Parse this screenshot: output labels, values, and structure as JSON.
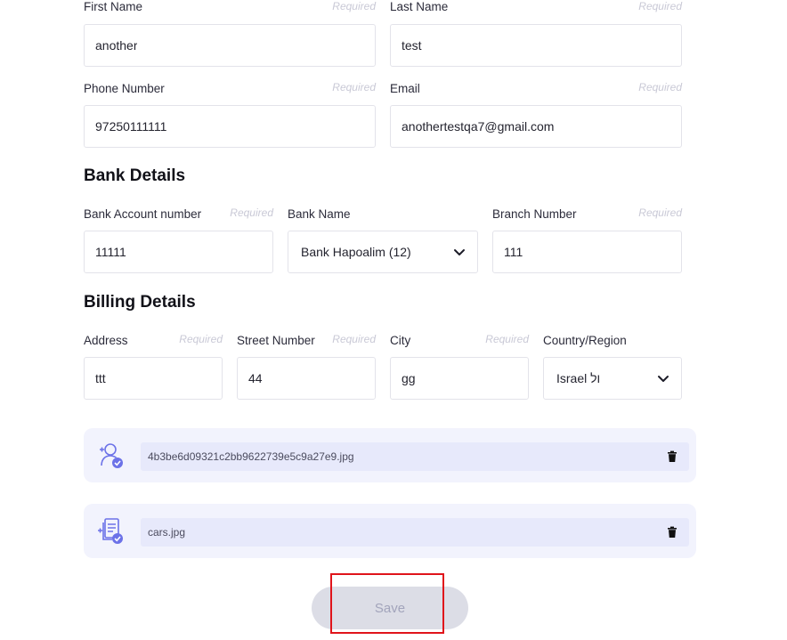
{
  "personal": {
    "first_name": {
      "label": "First Name",
      "required": "Required",
      "value": "another"
    },
    "last_name": {
      "label": "Last Name",
      "required": "Required",
      "value": "test"
    },
    "phone": {
      "label": "Phone Number",
      "required": "Required",
      "value": "97250111111"
    },
    "email": {
      "label": "Email",
      "required": "Required",
      "value": "anothertestqa7@gmail.com"
    }
  },
  "bank": {
    "title": "Bank Details",
    "account": {
      "label": "Bank Account number",
      "required": "Required",
      "value": "11111"
    },
    "bank_name": {
      "label": "Bank Name",
      "value": "Bank Hapoalim (12)"
    },
    "branch": {
      "label": "Branch Number",
      "required": "Required",
      "value": "111"
    }
  },
  "billing": {
    "title": "Billing Details",
    "address": {
      "label": "Address",
      "required": "Required",
      "value": "ttt"
    },
    "street_number": {
      "label": "Street Number",
      "required": "Required",
      "value": "44"
    },
    "city": {
      "label": "City",
      "required": "Required",
      "value": "gg"
    },
    "country": {
      "label": "Country/Region",
      "value": "Israel ול"
    }
  },
  "uploads": [
    {
      "filename": "4b3be6d09321c2bb9622739e5c9a27e9.jpg",
      "icon": "user-check-icon"
    },
    {
      "filename": "cars.jpg",
      "icon": "document-check-icon"
    }
  ],
  "save_label": "Save",
  "colors": {
    "accent": "#6c72e8",
    "required": "#c9c9d6",
    "upload_bg": "#f2f3fd",
    "save_bg": "#dcdde6",
    "highlight": "#e0141b"
  }
}
